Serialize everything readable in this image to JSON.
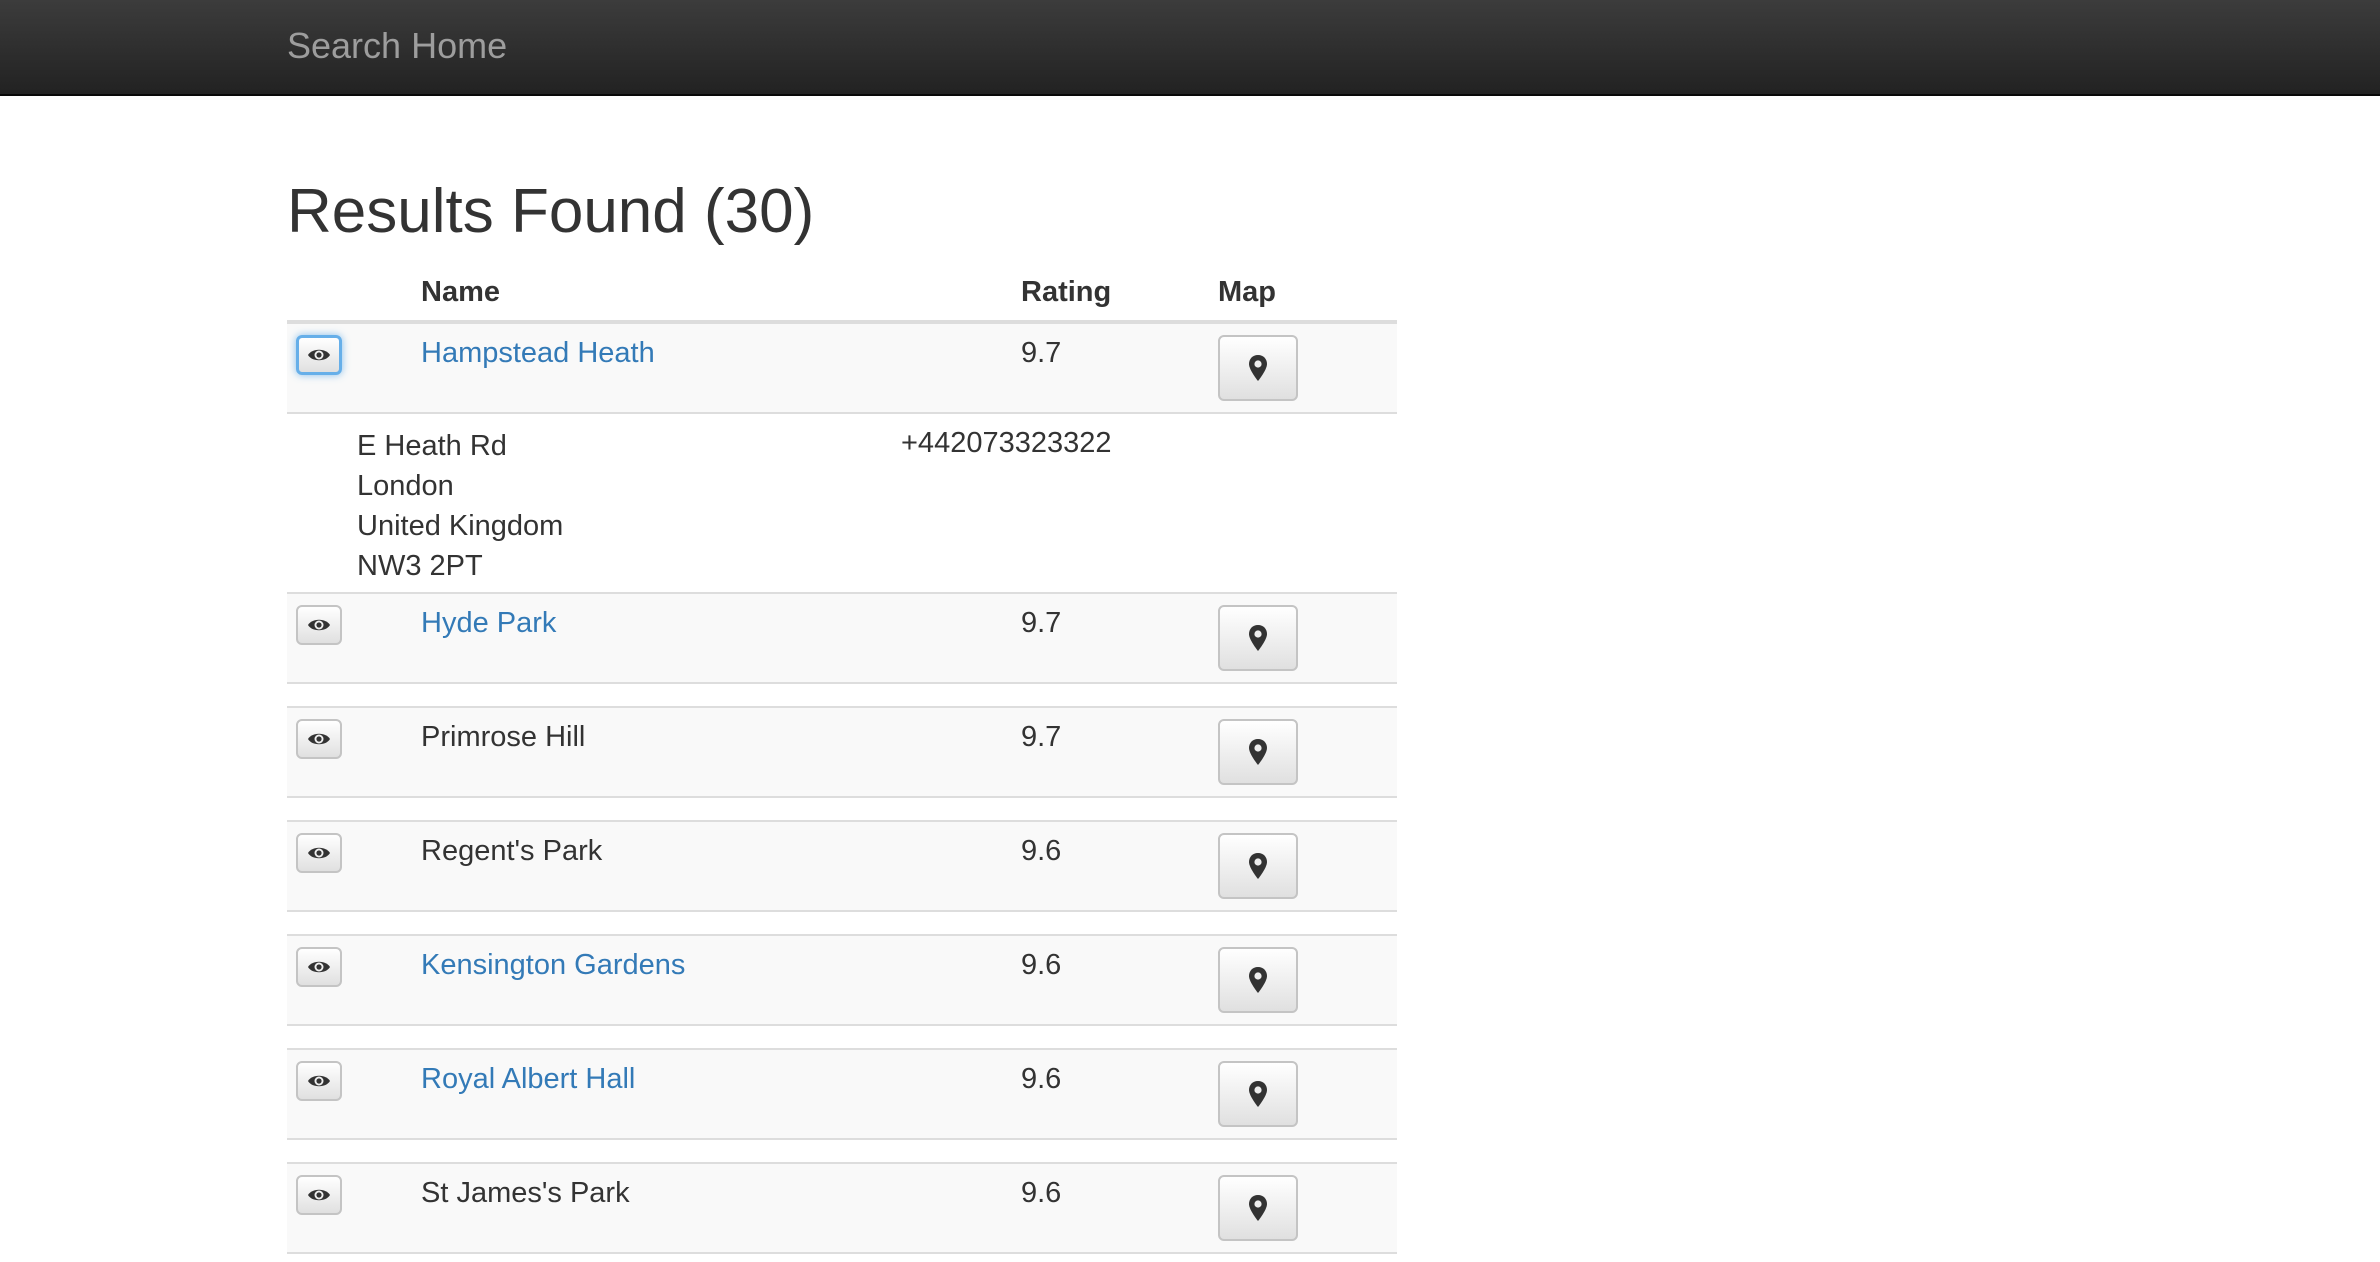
{
  "navbar": {
    "brand": "Search Home"
  },
  "page": {
    "title": "Results Found (30)"
  },
  "table": {
    "headers": {
      "name": "Name",
      "rating": "Rating",
      "map": "Map"
    },
    "rows": [
      {
        "name": "Hampstead Heath",
        "rating": "9.7",
        "linked": true,
        "expanded": true,
        "details": {
          "address": [
            "E Heath Rd",
            "London",
            "United Kingdom",
            "NW3 2PT"
          ],
          "phone": "+442073323322"
        }
      },
      {
        "name": "Hyde Park",
        "rating": "9.7",
        "linked": true
      },
      {
        "name": "Primrose Hill",
        "rating": "9.7",
        "linked": false
      },
      {
        "name": "Regent's Park",
        "rating": "9.6",
        "linked": false
      },
      {
        "name": "Kensington Gardens",
        "rating": "9.6",
        "linked": true
      },
      {
        "name": "Royal Albert Hall",
        "rating": "9.6",
        "linked": true
      },
      {
        "name": "St James's Park",
        "rating": "9.6",
        "linked": false
      }
    ]
  },
  "icons": {
    "toggle": "eye-icon",
    "map": "map-marker-icon"
  },
  "colors": {
    "link": "#337ab7",
    "navbar": "#222222",
    "focus": "#66afe9",
    "row_stripe": "#f9f9f9"
  }
}
